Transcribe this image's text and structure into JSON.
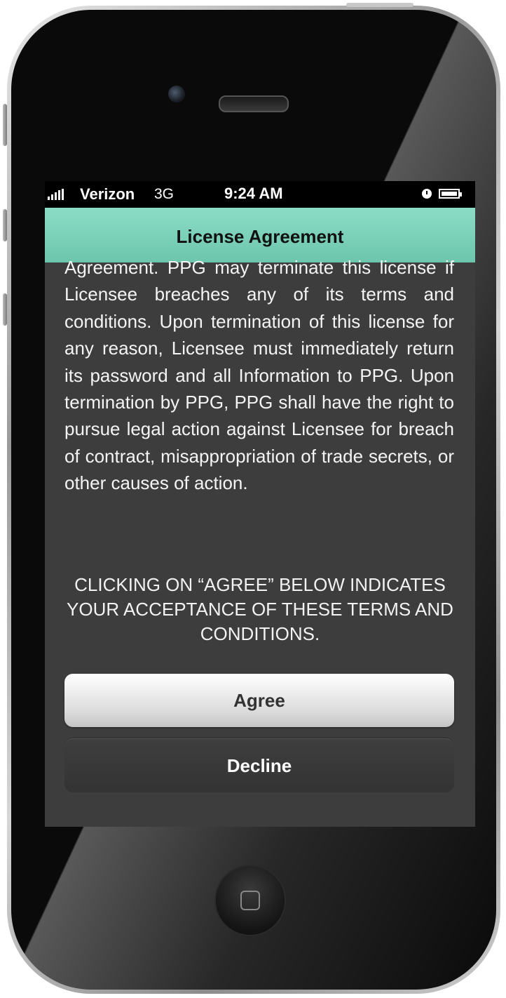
{
  "status_bar": {
    "carrier": "Verizon",
    "network": "3G",
    "time": "9:24 AM",
    "signal_icon": "signal-bars-icon",
    "clock_icon": "clock-icon",
    "battery_icon": "battery-icon"
  },
  "nav": {
    "title": "License Agreement"
  },
  "content": {
    "legal_text": "Agreement. PPG may terminate this license if Licensee breaches any of its terms and conditions. Upon termination of this license for any reason, Licensee must immediately return its password and all Information to PPG. Upon termination by PPG, PPG shall have the right to pursue legal action against Licensee for breach of contract, misappropriation of trade secrets, or other causes of action.",
    "acceptance_notice": "CLICKING ON “AGREE” BELOW INDICATES YOUR ACCEPTANCE OF THESE TERMS AND CONDITIONS."
  },
  "buttons": {
    "agree": "Agree",
    "decline": "Decline"
  },
  "colors": {
    "nav_bar": "#7ed4bc",
    "content_bg": "#3d3d3d"
  }
}
